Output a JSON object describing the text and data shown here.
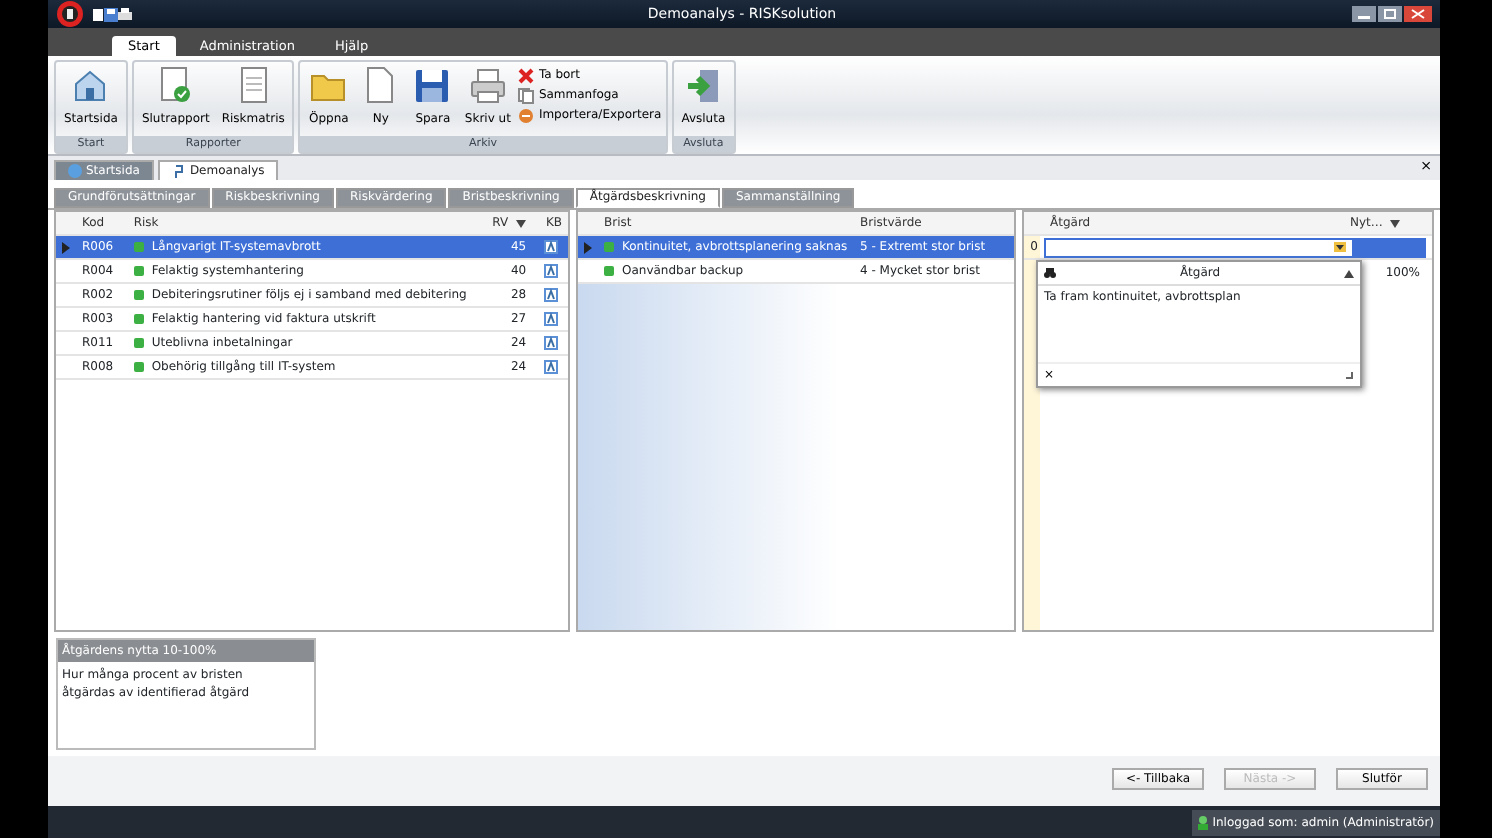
{
  "window": {
    "title": "Demoanalys - RISKsolution"
  },
  "ribbon_tabs": [
    {
      "label": "Start",
      "selected": true
    },
    {
      "label": "Administration",
      "selected": false
    },
    {
      "label": "Hjälp",
      "selected": false
    }
  ],
  "ribbon_groups": [
    {
      "label": "Start",
      "buttons": [
        {
          "label": "Startsida",
          "kind": "large"
        }
      ]
    },
    {
      "label": "Rapporter",
      "buttons": [
        {
          "label": "Slutrapport",
          "kind": "large"
        },
        {
          "label": "Riskmatris",
          "kind": "large"
        }
      ]
    },
    {
      "label": "Arkiv",
      "buttons": [
        {
          "label": "Öppna",
          "kind": "large"
        },
        {
          "label": "Ny",
          "kind": "large"
        },
        {
          "label": "Spara",
          "kind": "large"
        },
        {
          "label": "Skriv ut",
          "kind": "large"
        },
        {
          "label": "Ta bort",
          "kind": "small"
        },
        {
          "label": "Sammanfoga",
          "kind": "small"
        },
        {
          "label": "Importera/Exportera",
          "kind": "small"
        }
      ]
    },
    {
      "label": "Avsluta",
      "buttons": [
        {
          "label": "Avsluta",
          "kind": "large"
        }
      ]
    }
  ],
  "document_tabs": [
    {
      "label": "Startsida",
      "selected": false
    },
    {
      "label": "Demoanalys",
      "selected": true
    }
  ],
  "close_glyph": "×",
  "step_tabs": [
    {
      "label": "Grundförutsättningar",
      "selected": false
    },
    {
      "label": "Riskbeskrivning",
      "selected": false
    },
    {
      "label": "Riskvärdering",
      "selected": false
    },
    {
      "label": "Bristbeskrivning",
      "selected": false
    },
    {
      "label": "Åtgärdsbeskrivning",
      "selected": true
    },
    {
      "label": "Sammanställning",
      "selected": false
    }
  ],
  "risk_table": {
    "columns": [
      "Kod",
      "Risk",
      "RV",
      "KB"
    ],
    "rows": [
      {
        "code": "R006",
        "risk": "Långvarigt IT-systemavbrott",
        "rv": "45",
        "color": "#3cb043",
        "selected": true
      },
      {
        "code": "R004",
        "risk": "Felaktig systemhantering",
        "rv": "40",
        "color": "#3cb043",
        "selected": false
      },
      {
        "code": "R002",
        "risk": "Debiteringsrutiner följs ej i samband med debitering",
        "rv": "28",
        "color": "#3cb043",
        "selected": false
      },
      {
        "code": "R003",
        "risk": "Felaktig hantering vid faktura utskrift",
        "rv": "27",
        "color": "#3cb043",
        "selected": false
      },
      {
        "code": "R011",
        "risk": "Uteblivna inbetalningar",
        "rv": "24",
        "color": "#3cb043",
        "selected": false
      },
      {
        "code": "R008",
        "risk": "Obehörig tillgång till IT-system",
        "rv": "24",
        "color": "#3cb043",
        "selected": false
      }
    ]
  },
  "brist_table": {
    "columns": [
      "Brist",
      "Bristvärde"
    ],
    "rows": [
      {
        "brist": "Kontinuitet, avbrottsplanering saknas",
        "value": "5 - Extremt stor brist",
        "color": "#3cb043",
        "selected": true
      },
      {
        "brist": "Oanvändbar backup",
        "value": "4 - Mycket stor brist",
        "color": "#3cb043",
        "selected": false
      }
    ]
  },
  "atgard_table": {
    "columns": [
      "Åtgärd",
      "Nyt…"
    ],
    "edit_row_marker": "0",
    "rows": [
      {
        "nytta": "100%"
      }
    ],
    "dropdown": {
      "column": "Åtgärd",
      "items": [
        "Ta fram kontinuitet, avbrottsplan"
      ],
      "clear_glyph": "×"
    }
  },
  "info_panel": {
    "title": "Åtgärdens nytta 10-100%",
    "text": "Hur många procent av bristen åtgärdas av identifierad åtgärd"
  },
  "nav_buttons": [
    {
      "label": "<- Tillbaka",
      "disabled": false
    },
    {
      "label": "Nästa ->",
      "disabled": true
    },
    {
      "label": "Slutför",
      "disabled": false
    }
  ],
  "status_bar": {
    "text": "Inloggad som: admin (Administratör)"
  }
}
